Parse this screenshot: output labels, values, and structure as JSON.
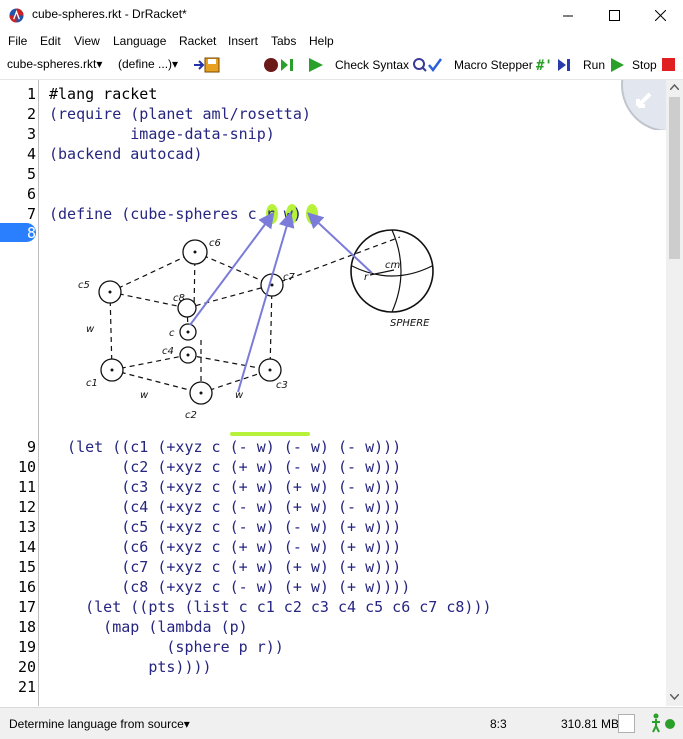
{
  "window": {
    "title": "cube-spheres.rkt - DrRacket*",
    "minimize": "—",
    "maximize": "☐",
    "close": "✕"
  },
  "menu": [
    "File",
    "Edit",
    "View",
    "Language",
    "Racket",
    "Insert",
    "Tabs",
    "Help"
  ],
  "toolbar": {
    "file_dropdown": "cube-spheres.rkt",
    "define_dropdown": "(define ...)",
    "check_syntax": "Check Syntax",
    "macro_stepper": "Macro Stepper",
    "run": "Run",
    "stop": "Stop"
  },
  "editor": {
    "line_numbers_top": [
      "1",
      "2",
      "3",
      "4",
      "5",
      "6",
      "7",
      "8"
    ],
    "line_numbers_bottom": [
      "9",
      "10",
      "11",
      "12",
      "13",
      "14",
      "15",
      "16",
      "17",
      "18",
      "19",
      "20",
      "21"
    ],
    "lines_top": [
      "#lang racket",
      "(require (planet aml/rosetta)",
      "         image-data-snip)",
      "(backend autocad)",
      "",
      "",
      "(define (cube-spheres c r w)"
    ],
    "lines_bottom": [
      "  (let ((c1 (+xyz c (- w) (- w) (- w)))",
      "        (c2 (+xyz c (+ w) (- w) (- w)))",
      "        (c3 (+xyz c (+ w) (+ w) (- w)))",
      "        (c4 (+xyz c (- w) (+ w) (- w)))",
      "        (c5 (+xyz c (- w) (- w) (+ w)))",
      "        (c6 (+xyz c (+ w) (- w) (+ w)))",
      "        (c7 (+xyz c (+ w) (+ w) (+ w)))",
      "        (c8 (+xyz c (- w) (+ w) (+ w))))",
      "    (let ((pts (list c c1 c2 c3 c4 c5 c6 c7 c8)))",
      "      (map (lambda (p)",
      "             (sphere p r))",
      "           pts))))",
      ""
    ],
    "sketch_labels": {
      "c1": "c1",
      "c2": "c2",
      "c3": "c3",
      "c4": "c4",
      "c5": "c5",
      "c6": "c6",
      "c7": "c7",
      "c8": "c8",
      "c": "c",
      "w1": "w",
      "w2": "w",
      "w3": "w",
      "cm": "cm",
      "r": "r",
      "sphere": "SPHERE"
    }
  },
  "status": {
    "language": "Determine language from source",
    "position": "8:3",
    "memory": "310.81 MB"
  },
  "colors": {
    "keyword": "#262680",
    "paren": "#8a4a2a",
    "active_line": "#2a7fff",
    "arrow": "#7b7bd9",
    "highlight": "#b7f23a",
    "run_green": "#2aa02a",
    "stop_red": "#e02020"
  }
}
